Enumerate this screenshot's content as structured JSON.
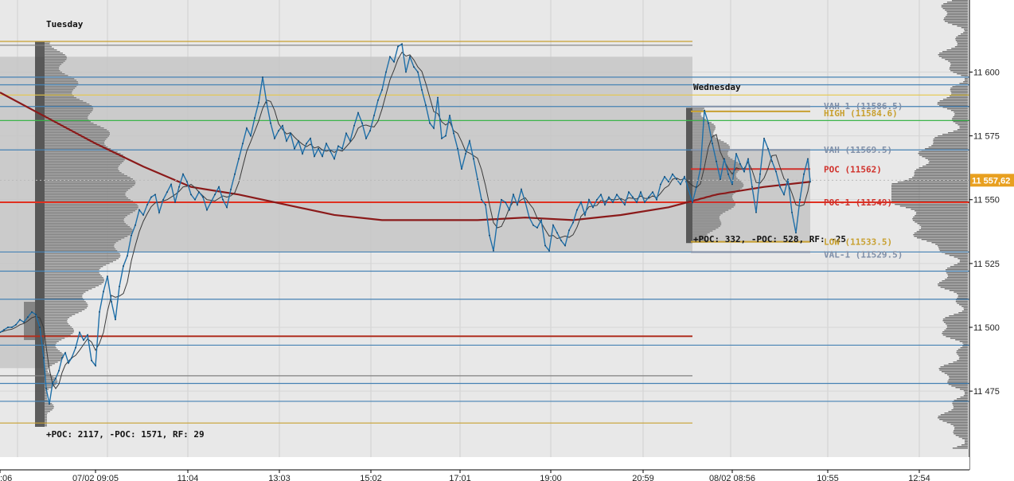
{
  "chart_data": {
    "type": "line",
    "instrument_axis": {
      "ticks": [
        "11 600",
        "11 575",
        "11 550",
        "11 525",
        "11 500",
        "11 475"
      ],
      "tick_values": [
        11600,
        11575,
        11550,
        11525,
        11500,
        11475
      ],
      "ylim": [
        11461,
        11617
      ],
      "current_price_label": "11 557,62",
      "current_price_value": 11557.62,
      "current_price_color": "#e8a020"
    },
    "time_axis": {
      "labels": [
        ":06",
        "07/02 09:05",
        "11:04",
        "13:03",
        "15:02",
        "17:01",
        "19:00",
        "20:59",
        "08/02 08:56",
        "10:55",
        "12:54"
      ]
    },
    "sessions": [
      {
        "name": "Tuesday",
        "stats": "+POC: 2117, -POC: 1571, RF: 29"
      },
      {
        "name": "Wednesday",
        "stats": "+POC: 332, -POC: 528, RF: -25",
        "levels": [
          {
            "label": "VAH-1 (11586.5)",
            "value": 11586.5,
            "color": "#7f8fa8"
          },
          {
            "label": "HIGH (11584.6)",
            "value": 11584.6,
            "color": "#c8a030"
          },
          {
            "label": "VAH (11569.5)",
            "value": 11569.5,
            "color": "#7f8fa8"
          },
          {
            "label": "POC (11562)",
            "value": 11562,
            "color": "#d0302a"
          },
          {
            "label": "POC-1 (11549)",
            "value": 11549,
            "color": "#d0302a"
          },
          {
            "label": "LOW (11533.5)",
            "value": 11533.5,
            "color": "#c8a030"
          },
          {
            "label": "VAL-1 (11529.5)",
            "value": 11529.5,
            "color": "#7f8fa8"
          }
        ]
      }
    ],
    "horizontal_lines": [
      {
        "value": 11612,
        "color": "#c8a030"
      },
      {
        "value": 11610.5,
        "color": "#808080"
      },
      {
        "value": 11598,
        "color": "#4682b4"
      },
      {
        "value": 11595,
        "color": "#4682b4"
      },
      {
        "value": 11591,
        "color": "#e6c84a"
      },
      {
        "value": 11586.5,
        "color": "#4682b4"
      },
      {
        "value": 11581,
        "color": "#3cb44b"
      },
      {
        "value": 11569.5,
        "color": "#4682b4"
      },
      {
        "value": 11549,
        "color": "#e03020"
      },
      {
        "value": 11529.5,
        "color": "#4682b4"
      },
      {
        "value": 11522,
        "color": "#4682b4"
      },
      {
        "value": 11511,
        "color": "#4682b4"
      },
      {
        "value": 11496.5,
        "color": "#b03020"
      },
      {
        "value": 11493,
        "color": "#4682b4"
      },
      {
        "value": 11481,
        "color": "#808080"
      },
      {
        "value": 11478,
        "color": "#4682b4"
      },
      {
        "value": 11471,
        "color": "#4682b4"
      },
      {
        "value": 11462.5,
        "color": "#c8a030"
      }
    ],
    "price_series": {
      "name": "",
      "color": "#1f6fa8",
      "x": [
        0,
        5,
        10,
        15,
        20,
        25,
        30,
        35,
        40,
        45,
        50,
        55,
        58,
        62,
        66,
        70,
        74,
        78,
        82,
        86,
        90,
        95,
        100,
        105,
        110,
        115,
        120,
        125,
        130,
        135,
        140,
        145,
        150,
        155,
        160,
        165,
        170,
        175,
        180,
        185,
        190,
        195,
        200,
        205,
        210,
        215,
        220,
        225,
        230,
        235,
        240,
        245,
        250,
        255,
        260,
        265,
        270,
        275,
        280,
        285,
        290,
        295,
        300,
        305,
        310,
        315,
        320,
        325,
        330,
        335,
        340,
        345,
        350,
        355,
        360,
        365,
        370,
        375,
        380,
        385,
        390,
        395,
        400,
        405,
        410,
        415,
        420,
        425,
        430,
        435,
        440,
        445,
        450,
        455,
        460,
        465,
        470,
        475,
        480,
        485,
        490,
        495,
        500,
        505,
        510,
        515,
        520,
        525,
        530,
        535,
        540,
        545,
        550,
        555,
        560,
        565,
        570,
        575,
        580,
        585,
        590,
        595,
        600,
        605,
        610,
        615,
        620,
        625,
        630,
        635,
        640,
        645,
        650,
        655,
        660,
        665,
        670,
        675,
        680,
        685,
        690,
        695,
        700,
        705,
        710,
        715,
        720,
        725,
        730,
        735,
        740,
        745,
        750,
        755,
        760,
        765,
        770,
        775,
        780,
        785,
        790,
        795,
        800,
        805,
        810,
        815,
        820,
        825,
        830,
        835,
        840,
        845,
        850,
        855,
        860,
        870,
        875,
        880,
        885,
        890,
        895,
        900,
        905,
        910,
        915,
        920,
        925,
        930,
        935,
        940,
        945,
        950,
        955,
        960,
        965,
        970,
        975,
        980,
        985,
        990,
        995,
        1000,
        1005,
        1010,
        1015,
        1018
      ],
      "values": [
        11498,
        11499,
        11500,
        11500,
        11501,
        11503,
        11502,
        11504,
        11506,
        11505,
        11500,
        11488,
        11476,
        11470,
        11478,
        11480,
        11483,
        11488,
        11490,
        11486,
        11488,
        11492,
        11498,
        11495,
        11497,
        11487,
        11485,
        11506,
        11514,
        11520,
        11510,
        11503,
        11516,
        11524,
        11528,
        11536,
        11540,
        11546,
        11544,
        11548,
        11551,
        11552,
        11545,
        11550,
        11553,
        11556,
        11549,
        11555,
        11560,
        11557,
        11552,
        11550,
        11553,
        11551,
        11546,
        11549,
        11552,
        11555,
        11550,
        11547,
        11554,
        11560,
        11566,
        11572,
        11578,
        11575,
        11582,
        11588,
        11598,
        11588,
        11580,
        11574,
        11577,
        11579,
        11573,
        11576,
        11570,
        11573,
        11568,
        11572,
        11574,
        11567,
        11570,
        11567,
        11572,
        11569,
        11566,
        11571,
        11570,
        11576,
        11573,
        11579,
        11584,
        11580,
        11574,
        11577,
        11583,
        11589,
        11593,
        11600,
        11606,
        11604,
        11610,
        11611,
        11600,
        11606,
        11602,
        11600,
        11593,
        11587,
        11580,
        11578,
        11590,
        11574,
        11575,
        11583,
        11576,
        11570,
        11562,
        11568,
        11573,
        11566,
        11558,
        11550,
        11548,
        11536,
        11530,
        11542,
        11550,
        11549,
        11546,
        11552,
        11548,
        11554,
        11549,
        11543,
        11540,
        11539,
        11542,
        11532,
        11530,
        11540,
        11537,
        11534,
        11532,
        11538,
        11541,
        11546,
        11549,
        11544,
        11550,
        11547,
        11550,
        11552,
        11548,
        11551,
        11549,
        11552,
        11550,
        11548,
        11553,
        11551,
        11549,
        11553,
        11549,
        11551,
        11553,
        11550,
        11556,
        11559,
        11557,
        11560,
        11558,
        11556,
        11559,
        11549,
        11555,
        11562,
        11585,
        11580,
        11572,
        11565,
        11558,
        11566,
        11560,
        11556,
        11568,
        11564,
        11561,
        11566,
        11555,
        11545,
        11560,
        11574,
        11570,
        11565,
        11561,
        11555,
        11552,
        11558,
        11545,
        11537,
        11550,
        11560,
        11566,
        11557,
        11552,
        11556
      ]
    },
    "moving_average": {
      "name": "",
      "color": "#8b1a1a",
      "x": [
        0,
        60,
        120,
        180,
        240,
        300,
        360,
        420,
        480,
        540,
        600,
        660,
        720,
        780,
        840,
        900,
        960,
        1018
      ],
      "values": [
        11592,
        11582,
        11572,
        11563,
        11555,
        11552,
        11548,
        11544,
        11542,
        11542,
        11542,
        11543,
        11542,
        11544,
        11547,
        11552,
        11555,
        11557
      ]
    }
  }
}
